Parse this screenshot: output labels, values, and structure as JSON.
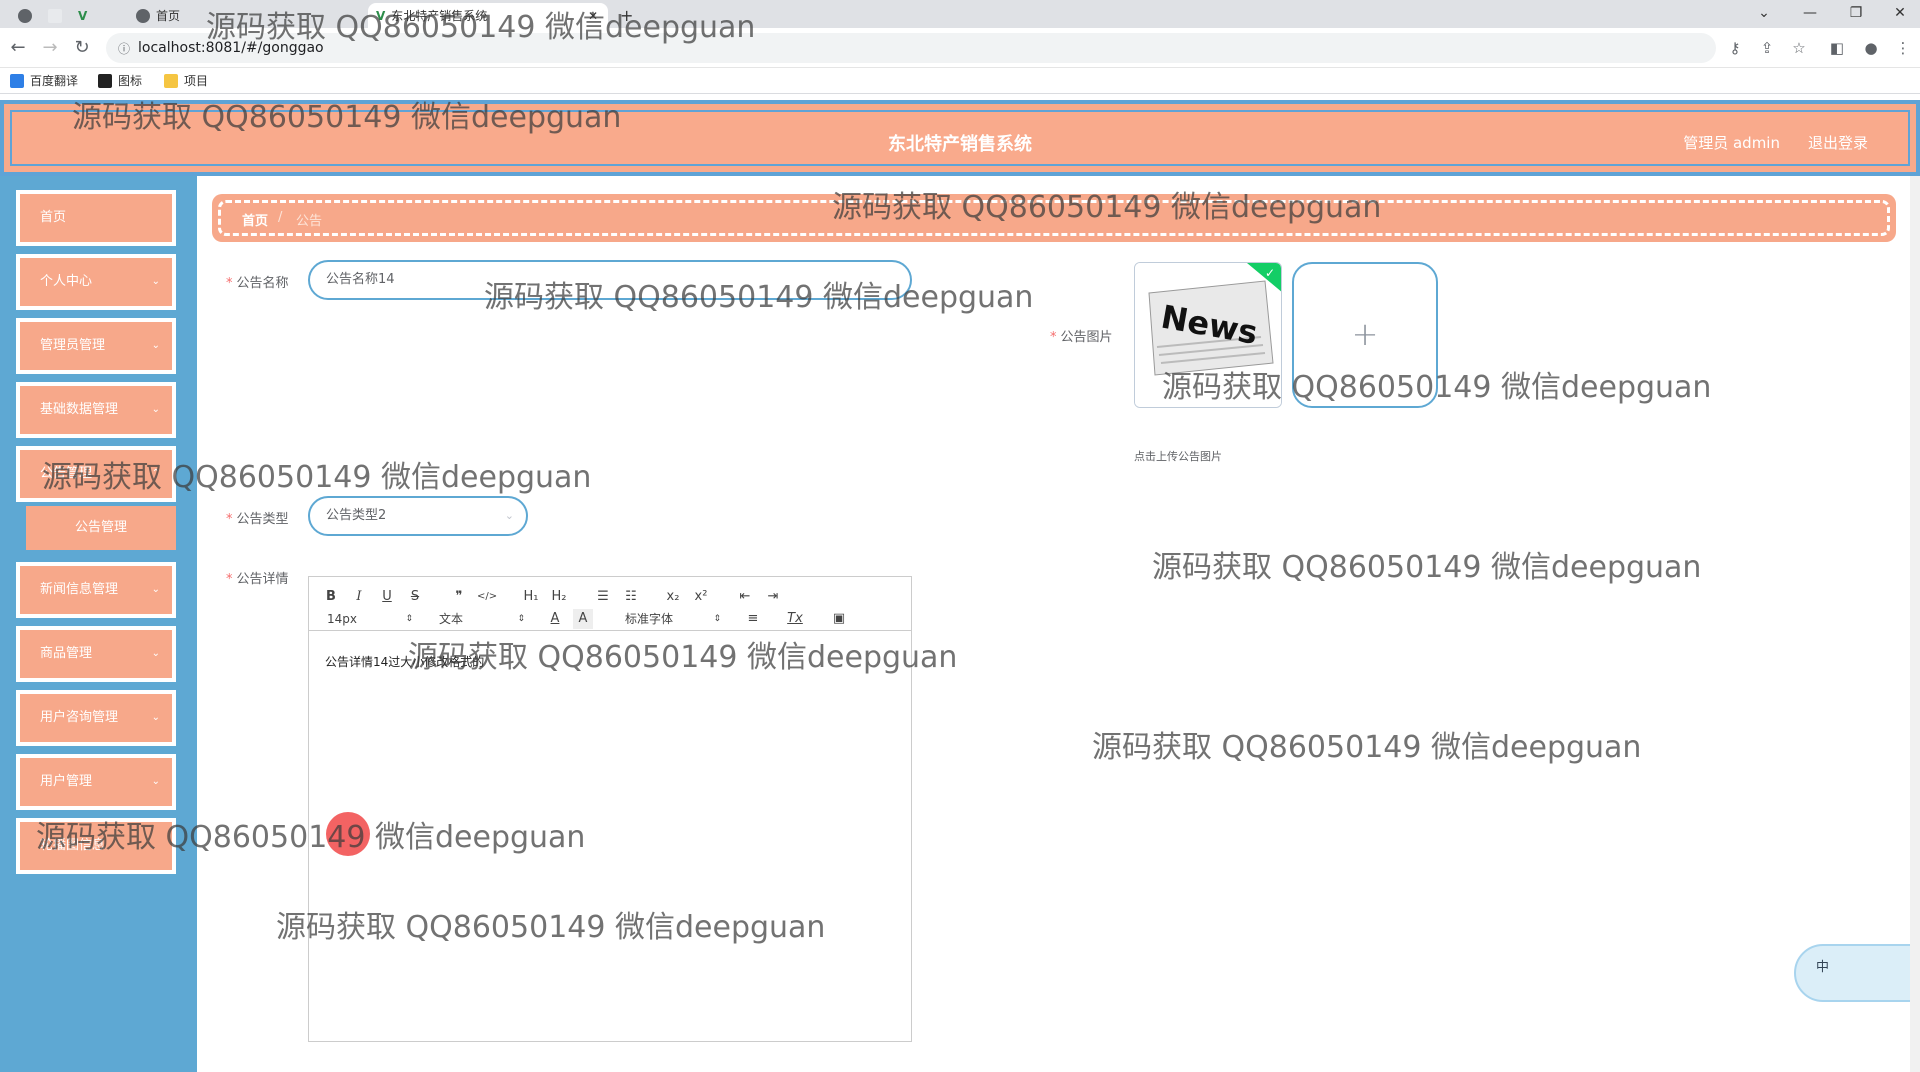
{
  "browser": {
    "tabs": [
      {
        "label": "首页"
      },
      {
        "label": "东北特产销售系统"
      }
    ],
    "new_tab": "+",
    "window_buttons": [
      "⌄",
      "—",
      "❐",
      "✕"
    ],
    "url": "localhost:8081/#/gonggao",
    "bookmarks": [
      {
        "label": "百度翻译"
      },
      {
        "label": "图标"
      },
      {
        "label": "项目"
      }
    ]
  },
  "header": {
    "title": "东北特产销售系统",
    "admin": "管理员 admin",
    "logout": "退出登录"
  },
  "sidebar": {
    "items": [
      {
        "label": "首页",
        "has_children": false
      },
      {
        "label": "个人中心",
        "has_children": true
      },
      {
        "label": "管理员管理",
        "has_children": true
      },
      {
        "label": "基础数据管理",
        "has_children": true
      },
      {
        "label": "公告管理",
        "has_children": true
      },
      {
        "label": "新闻信息管理",
        "has_children": true
      },
      {
        "label": "商品管理",
        "has_children": true
      },
      {
        "label": "用户咨询管理",
        "has_children": true
      },
      {
        "label": "用户管理",
        "has_children": true
      },
      {
        "label": "轮播图信息",
        "has_children": false
      }
    ],
    "submenu_active": "公告管理"
  },
  "breadcrumb": {
    "home": "首页",
    "separator": "/",
    "current": "公告"
  },
  "form": {
    "title_label": "公告名称",
    "title_value": "公告名称14",
    "image_label": "公告图片",
    "image_content": "News",
    "upload_plus": "+",
    "upload_tip": "点击上传公告图片",
    "type_label": "公告类型",
    "type_value": "公告类型2",
    "detail_label": "公告详情",
    "detail_value": "公告详情14过大小修改格式的"
  },
  "editor_toolbar": {
    "bold": "B",
    "italic": "I",
    "underline": "U",
    "strike": "S",
    "quote": "❞",
    "code": "</>",
    "h1": "H₁",
    "h2": "H₂",
    "ordered": "☰",
    "bullet": "☷",
    "sub": "x₂",
    "sup": "x²",
    "outdent": "⇤",
    "indent": "⇥",
    "size": "14px",
    "format": "文本",
    "font": "标准字体",
    "color": "A",
    "bg": "A",
    "align": "≡",
    "clean": "Tx",
    "image": "▣"
  },
  "ime": {
    "label": "中"
  },
  "watermark": "源码获取 QQ86050149 微信deepguan",
  "colors": {
    "header": "#f9aa8c",
    "sidebar": "#5ea8d3",
    "accent": "#f7a88a"
  }
}
